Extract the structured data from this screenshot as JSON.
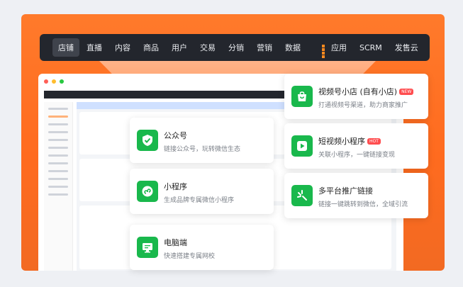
{
  "nav": {
    "items": [
      "店铺",
      "直播",
      "内容",
      "商品",
      "用户",
      "交易",
      "分销",
      "营销",
      "数据"
    ],
    "app_label": "应用",
    "extra": [
      "SCRM",
      "发售云"
    ]
  },
  "cards": [
    {
      "title": "公众号",
      "desc": "链接公众号，玩转微信生态",
      "icon": "shield-check-icon"
    },
    {
      "title": "小程序",
      "desc": "生成品牌专属微信小程序",
      "icon": "mini-program-icon"
    },
    {
      "title": "电脑端",
      "desc": "快速搭建专属网校",
      "icon": "monitor-icon"
    },
    {
      "title": "视频号小店 (自有小店)",
      "tag": "NEW",
      "desc": "打通视频号渠道，助力商家推广",
      "icon": "shop-bag-icon"
    },
    {
      "title": "短视频小程序",
      "tag": "HOT",
      "desc": "关联小程序，一键链接变现",
      "icon": "video-play-icon"
    },
    {
      "title": "多平台推广链接",
      "desc": "链接一键跳转到微信，全域引流",
      "icon": "link-spark-icon"
    }
  ],
  "colors": {
    "accent": "#ff7a2b",
    "nav_bg": "#23262d",
    "icon_green": "#19b84c",
    "tag_new": "#ff4d4f",
    "tag_hot": "#ff4d4f"
  }
}
